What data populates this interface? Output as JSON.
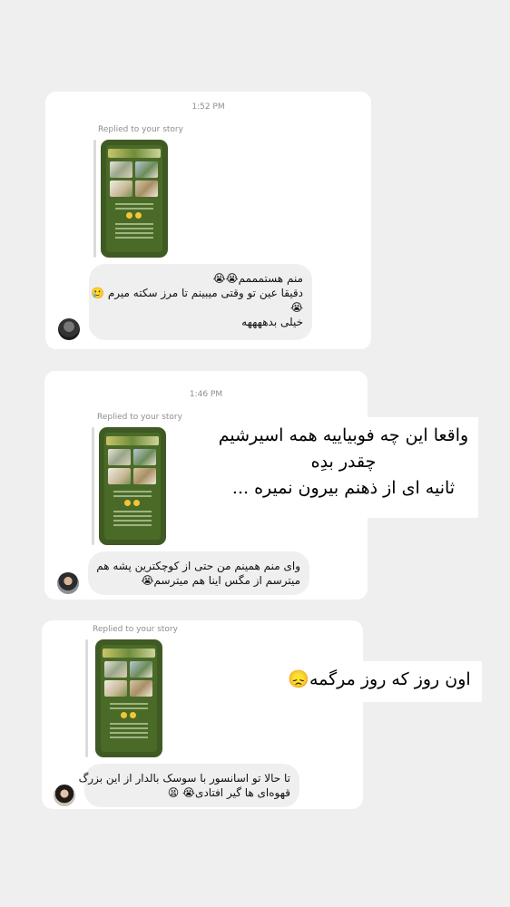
{
  "messages": [
    {
      "time": "1:52 PM",
      "replied_label": "Replied to your story",
      "text_lines": [
        "منم هستمممم😭😭",
        "دقیقا عین تو وقتی میبینم تا مرز سکته میرم 🥲",
        "😭",
        "خیلی بدههههه"
      ],
      "avatar": "user-avatar-1"
    },
    {
      "time": "1:46 PM",
      "replied_label": "Replied to your story",
      "text_lines": [
        "وای منم همینم من حتی از کوچکترین پشه هم",
        "میترسم از مگس اینا هم میترسم😭"
      ],
      "avatar": "user-avatar-2"
    },
    {
      "time": "",
      "replied_label": "Replied to your story",
      "text_lines": [
        "تا حالا تو اسانسور با سوسک بالدار از این بزرگ",
        "قهوه‌ای ها گیر افتادی😭 😫"
      ],
      "avatar": "user-avatar-3"
    }
  ],
  "overlays": [
    {
      "lines": [
        "واقعا این چه فوبیاییه همه اسیرشیم",
        "چقدر بدِه",
        "ثانیه ای از ذهنم بیرون نمیره ..."
      ]
    },
    {
      "lines": [
        "اون روز که روز مرگمه😞"
      ]
    }
  ],
  "colors": {
    "background": "#efefef",
    "card": "#ffffff",
    "bubble": "#efefef",
    "muted_text": "#8e8e8e",
    "story_green": "#3f5a22"
  }
}
